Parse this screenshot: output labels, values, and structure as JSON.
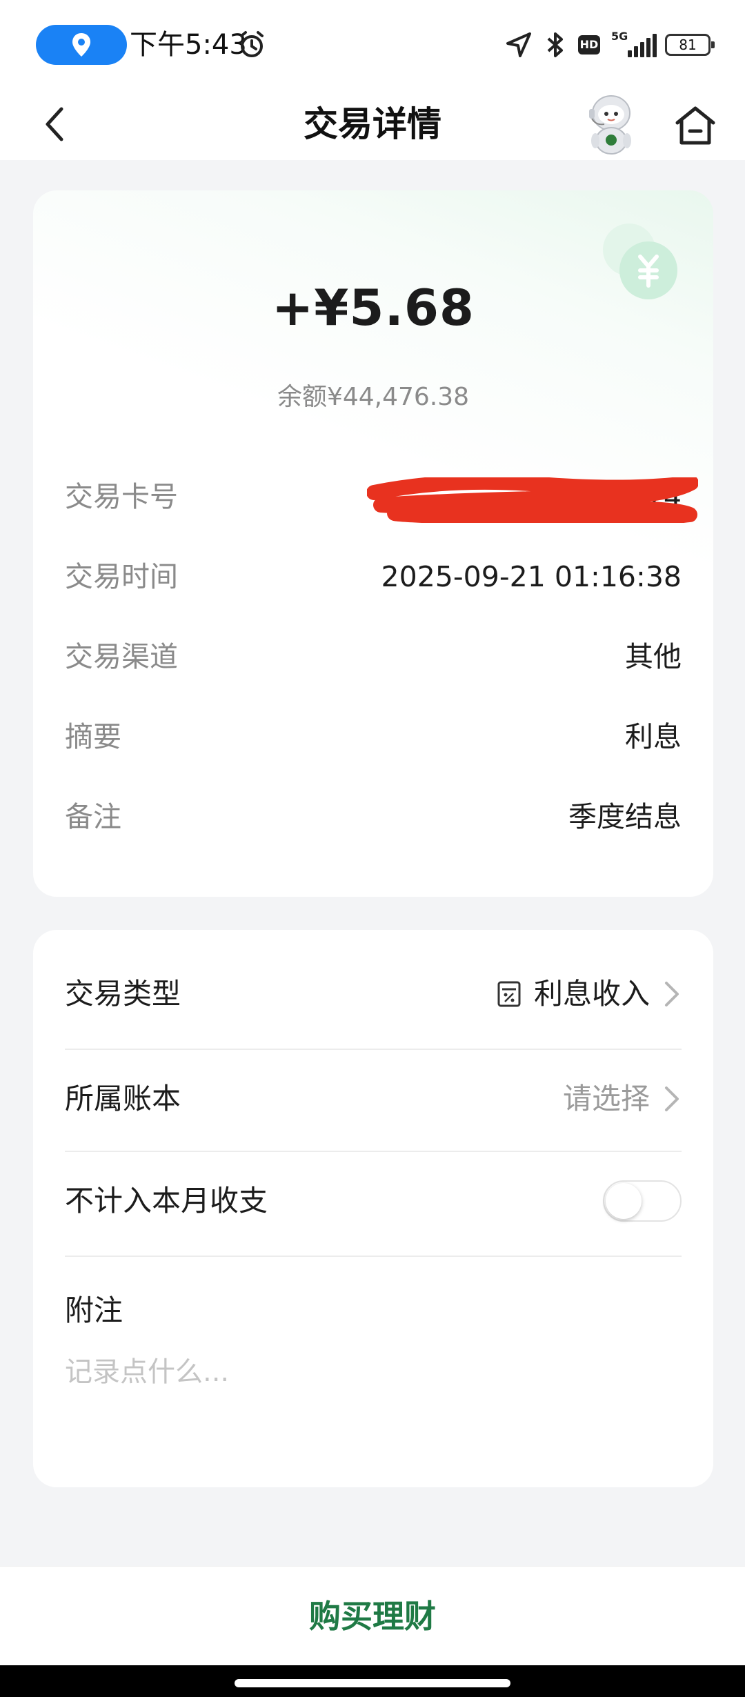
{
  "status_bar": {
    "time": "下午5:43",
    "network": "5G",
    "hd_badge": "HD",
    "battery": "81"
  },
  "nav": {
    "title": "交易详情"
  },
  "transaction": {
    "amount": "+¥5.68",
    "balance": "余额¥44,476.38",
    "rows": [
      {
        "label": "交易卡号",
        "value": "7874"
      },
      {
        "label": "交易时间",
        "value": "2025-09-21 01:16:38"
      },
      {
        "label": "交易渠道",
        "value": "其他"
      },
      {
        "label": "摘要",
        "value": "利息"
      },
      {
        "label": "备注",
        "value": "季度结息"
      }
    ]
  },
  "classification": {
    "type_label": "交易类型",
    "type_value": "利息收入",
    "type_icon": "calculator-percent-icon",
    "book_label": "所属账本",
    "book_value": "请选择",
    "exclude_label": "不计入本月收支",
    "exclude_on": false,
    "note_label": "附注",
    "note_placeholder": "记录点什么..."
  },
  "bottom": {
    "buy_label": "购买理财"
  },
  "colors": {
    "brand_green": "#1f7a45",
    "status_blue": "#1a82f5",
    "redaction_red": "#e8321f"
  }
}
